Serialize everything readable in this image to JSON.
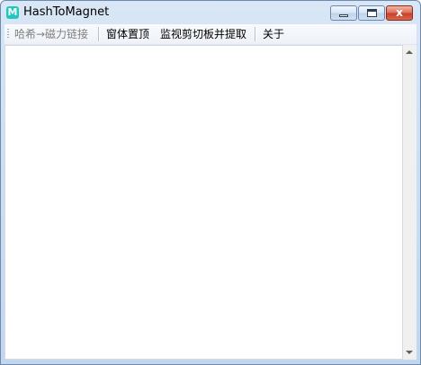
{
  "window": {
    "title": "HashToMagnet",
    "app_icon_letter": "M",
    "controls": {
      "minimize": "",
      "maximize": "",
      "close": "x"
    }
  },
  "menu": {
    "items": [
      {
        "label": "哈希→磁力链接",
        "enabled": false
      },
      {
        "label": "窗体置顶",
        "enabled": true
      },
      {
        "label": "监视剪切板并提取",
        "enabled": true
      },
      {
        "label": "关于",
        "enabled": true
      }
    ]
  },
  "content": {
    "text": ""
  },
  "colors": {
    "app_icon": "#20c7c0",
    "close_button": "#c7402a",
    "title_frame": "#c2d6ee"
  }
}
